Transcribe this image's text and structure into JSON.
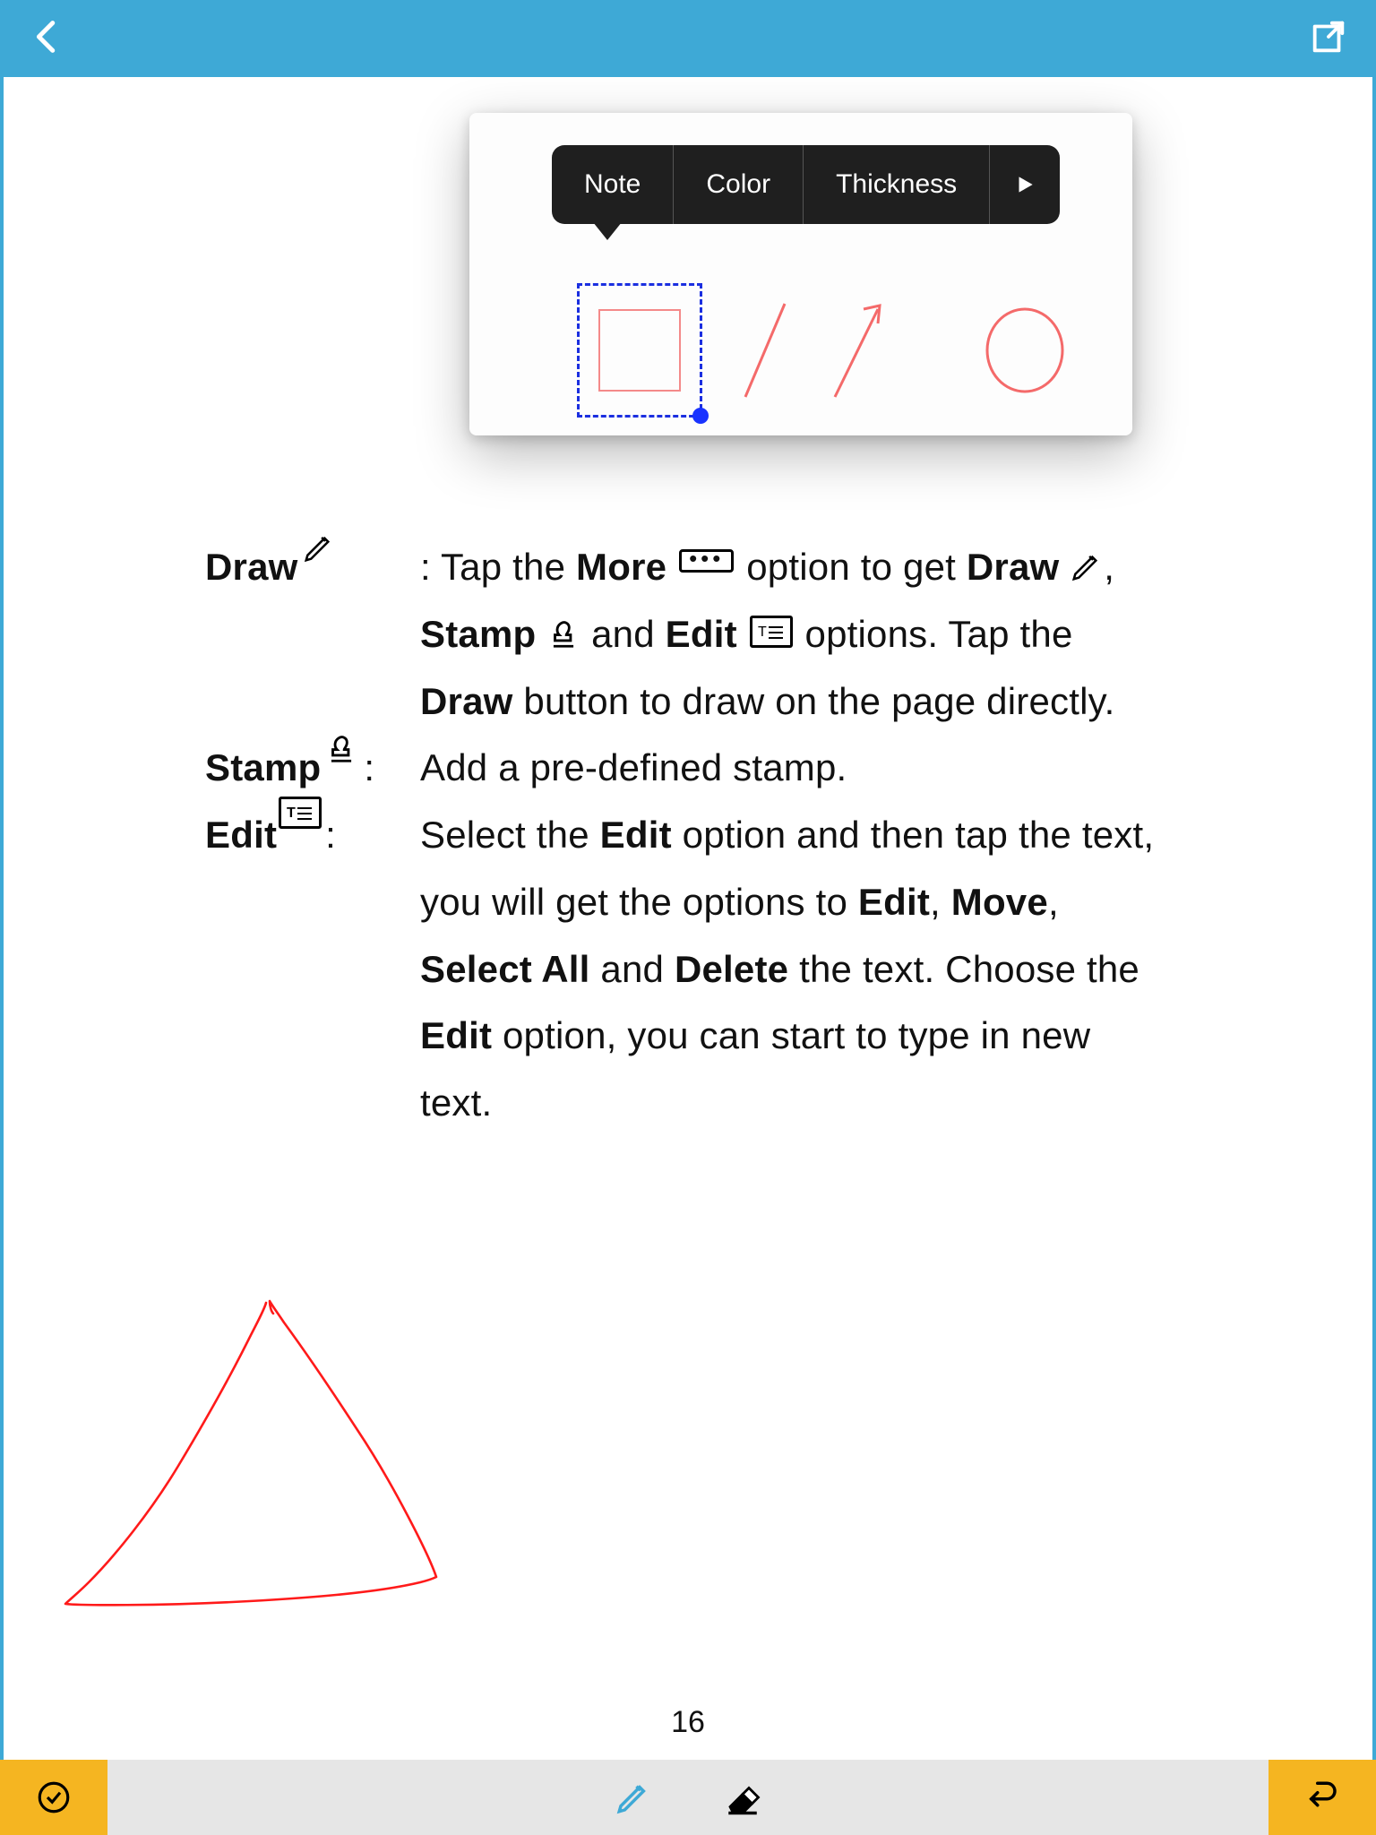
{
  "popover": {
    "tabs": [
      "Note",
      "Color",
      "Thickness"
    ]
  },
  "doc": {
    "draw": {
      "label": "Draw",
      "line1a": ": Tap the ",
      "line1b": "More",
      "line1c": "  option to get ",
      "line2a": "Draw",
      "line2b": ", ",
      "line2c": "Stamp",
      "line2d": "  and ",
      "line2e": "Edit",
      "line3": " options. Tap the ",
      "line3b": "Draw",
      "line3c": " button to draw on the page directly."
    },
    "stamp": {
      "label": "Stamp",
      "body": "Add a pre-defined stamp."
    },
    "edit": {
      "label": "Edit",
      "b1": "Select the ",
      "b2": "Edit",
      "b3": " option and then tap the text, you will get the options to ",
      "b4": "Edit",
      "b5": ", ",
      "b6": "Move",
      "b7": ", ",
      "b8": "Select All",
      "b9": " and ",
      "b10": "Delete",
      "b11": " the text. Choose the ",
      "b12": "Edit",
      "b13": " option, you can start to type in new text."
    }
  },
  "page_number": "16"
}
